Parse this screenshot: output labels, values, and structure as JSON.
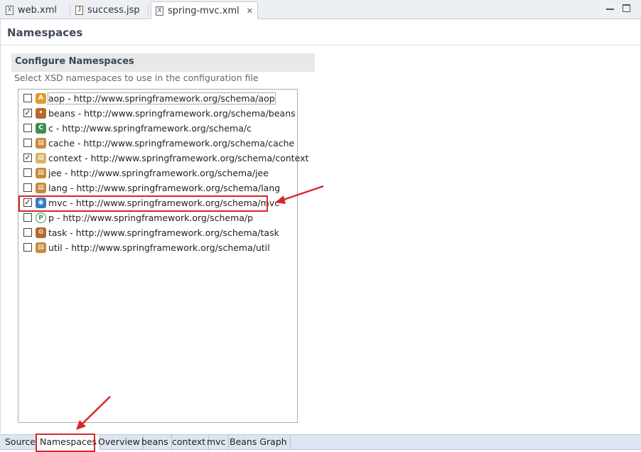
{
  "editor_tabs": [
    {
      "label": "web.xml",
      "icon": "xml-file-icon",
      "active": false
    },
    {
      "label": "success.jsp",
      "icon": "jsp-file-icon",
      "active": false
    },
    {
      "label": "spring-mvc.xml",
      "icon": "xml-file-icon",
      "active": true,
      "close": "✕"
    }
  ],
  "page": {
    "title": "Namespaces",
    "section_title": "Configure Namespaces",
    "section_description": "Select XSD namespaces to use in the configuration file"
  },
  "namespaces": [
    {
      "label": "aop - http://www.springframework.org/schema/aop",
      "checked": false,
      "icon": "aop-icon"
    },
    {
      "label": "beans - http://www.springframework.org/schema/beans",
      "checked": true,
      "icon": "beans-icon"
    },
    {
      "label": "c - http://www.springframework.org/schema/c",
      "checked": false,
      "icon": "c-icon"
    },
    {
      "label": "cache - http://www.springframework.org/schema/cache",
      "checked": false,
      "icon": "cache-icon"
    },
    {
      "label": "context - http://www.springframework.org/schema/context",
      "checked": true,
      "icon": "context-icon"
    },
    {
      "label": "jee - http://www.springframework.org/schema/jee",
      "checked": false,
      "icon": "jee-icon"
    },
    {
      "label": "lang - http://www.springframework.org/schema/lang",
      "checked": false,
      "icon": "lang-icon"
    },
    {
      "label": "mvc - http://www.springframework.org/schema/mvc",
      "checked": true,
      "icon": "mvc-icon"
    },
    {
      "label": "p - http://www.springframework.org/schema/p",
      "checked": false,
      "icon": "p-icon"
    },
    {
      "label": "task - http://www.springframework.org/schema/task",
      "checked": false,
      "icon": "task-icon"
    },
    {
      "label": "util - http://www.springframework.org/schema/util",
      "checked": false,
      "icon": "util-icon"
    }
  ],
  "page_tabs": [
    {
      "label": "Source",
      "active": false
    },
    {
      "label": "Namespaces",
      "active": true
    },
    {
      "label": "Overview",
      "active": false
    },
    {
      "label": "beans",
      "active": false
    },
    {
      "label": "context",
      "active": false
    },
    {
      "label": "mvc",
      "active": false
    },
    {
      "label": "Beans Graph",
      "active": false
    }
  ],
  "colors": {
    "annotation_red": "#d9262b",
    "section_header_bg": "#e8e8e8",
    "page_tab_strip": "#dde6f0"
  }
}
